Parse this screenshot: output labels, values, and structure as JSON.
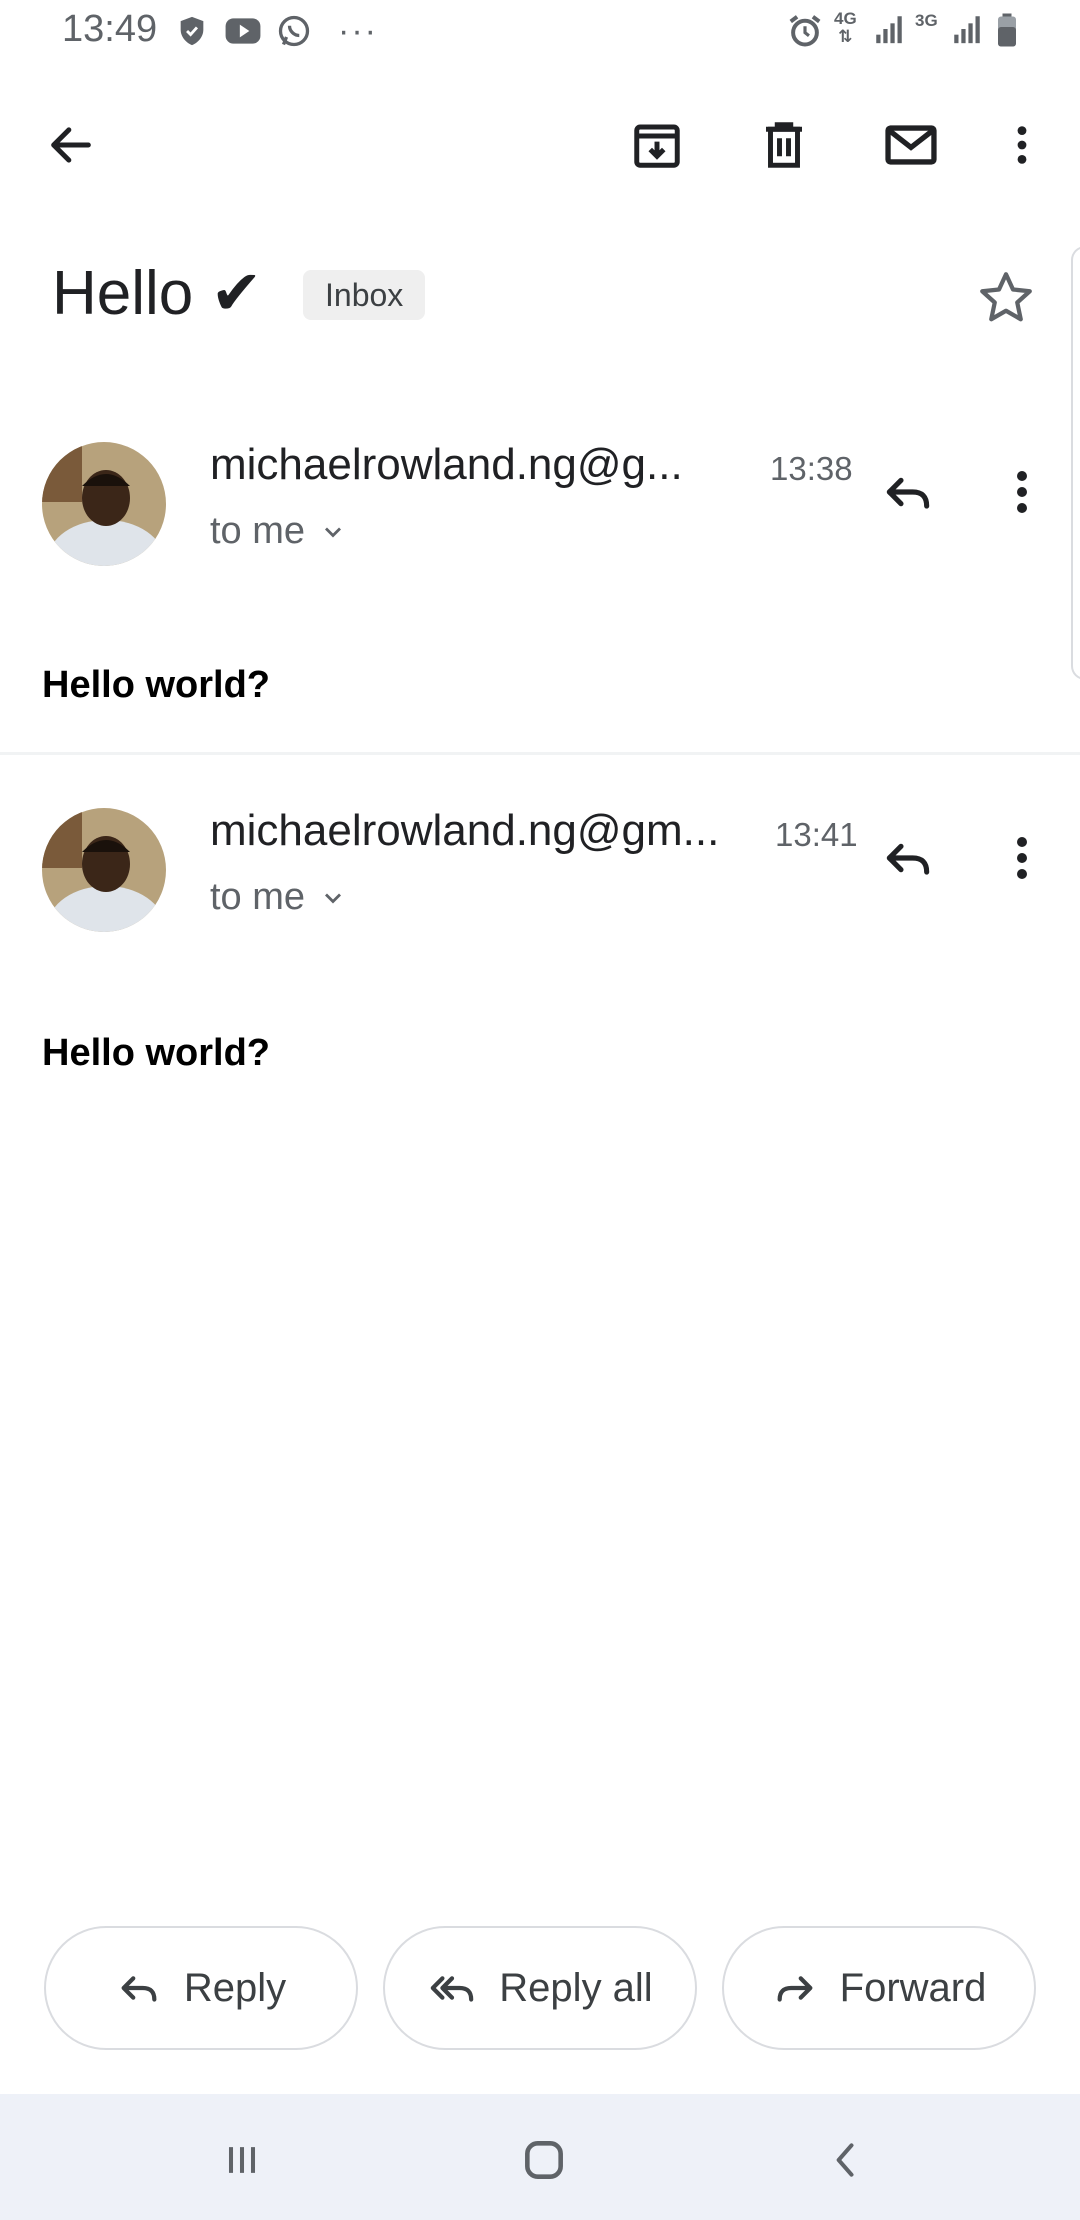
{
  "status_bar": {
    "time": "13:49",
    "network_1": "4G",
    "network_2": "3G"
  },
  "toolbar": {
    "icons": [
      "back-arrow-icon",
      "archive-icon",
      "delete-icon",
      "mark-unread-icon",
      "more-vert-icon"
    ]
  },
  "email": {
    "subject": "Hello ✔",
    "label": "Inbox"
  },
  "messages": [
    {
      "sender": "michaelrowland.ng@g...",
      "time": "13:38",
      "recipient": "to me",
      "body": "Hello world?"
    },
    {
      "sender": "michaelrowland.ng@gm...",
      "time": "13:41",
      "recipient": "to me",
      "body": "Hello world?"
    }
  ],
  "actions": {
    "reply": "Reply",
    "reply_all": "Reply all",
    "forward": "Forward"
  },
  "colors": {
    "icon": "#202124",
    "secondary_text": "#5f6368",
    "nav_bar": "#eef1f8"
  }
}
